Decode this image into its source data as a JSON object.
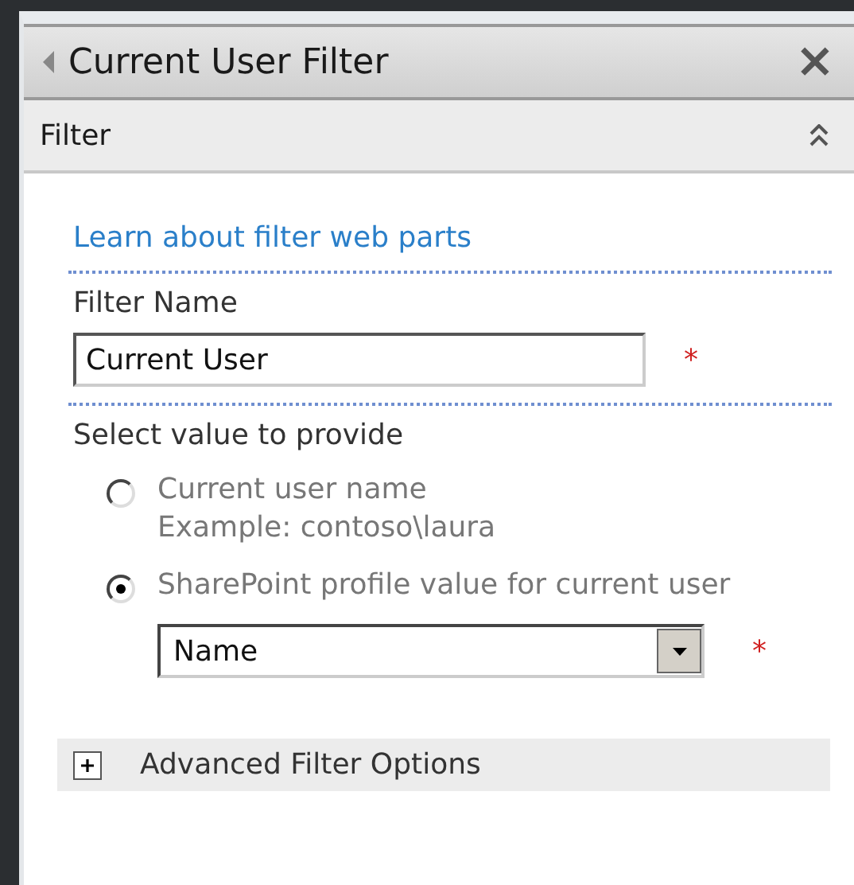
{
  "panel": {
    "title": "Current User Filter",
    "close": "×"
  },
  "section": {
    "title": "Filter",
    "expanded": true
  },
  "link": "Learn about filter web parts",
  "filter_name": {
    "label": "Filter Name",
    "value": "Current User",
    "required": "*"
  },
  "value_to_provide": {
    "label": "Select value to provide",
    "options": [
      {
        "label": "Current user name",
        "example": "Example: contoso\\laura",
        "selected": false
      },
      {
        "label": "SharePoint profile value for current user",
        "selected": true
      }
    ],
    "dropdown": {
      "value": "Name",
      "required": "*"
    }
  },
  "advanced": {
    "label": "Advanced Filter Options",
    "expanded": false
  }
}
